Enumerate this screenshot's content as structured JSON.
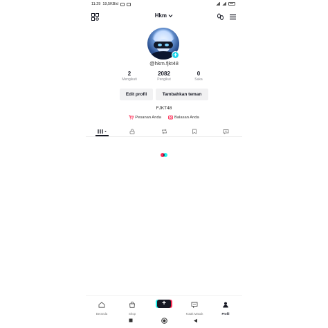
{
  "status_bar": {
    "time": "11:29",
    "speed": "19,5KB/d"
  },
  "header": {
    "title": "Hkm"
  },
  "profile": {
    "username": "@hkm.fjkt48",
    "bio": "FJKT48"
  },
  "stats": [
    {
      "value": "2",
      "label": "Mengikuti"
    },
    {
      "value": "2082",
      "label": "Pengikut"
    },
    {
      "value": "0",
      "label": "Suka"
    }
  ],
  "buttons": {
    "edit_profile": "Edit profil",
    "add_friends": "Tambahkan teman"
  },
  "links": {
    "orders": "Pesanan Anda",
    "replies": "Balasan Anda"
  },
  "bottom_nav": [
    {
      "label": "Beranda"
    },
    {
      "label": "Shop"
    },
    {
      "label": "Kotak Masuk"
    },
    {
      "label": "Profil"
    }
  ],
  "colors": {
    "accent_pink": "#fe2c55",
    "accent_cyan": "#25f4ee",
    "badge": "#20d5ec",
    "text": "#161823"
  },
  "icons": [
    "qr-code-icon",
    "chevron-down-icon",
    "footprint-icon",
    "menu-icon",
    "grid-icon",
    "lock-icon",
    "repost-icon",
    "bookmark-icon",
    "liked-icon",
    "cart-icon",
    "camera-icon",
    "home-icon",
    "shop-icon",
    "plus-icon",
    "inbox-icon",
    "profile-icon"
  ]
}
